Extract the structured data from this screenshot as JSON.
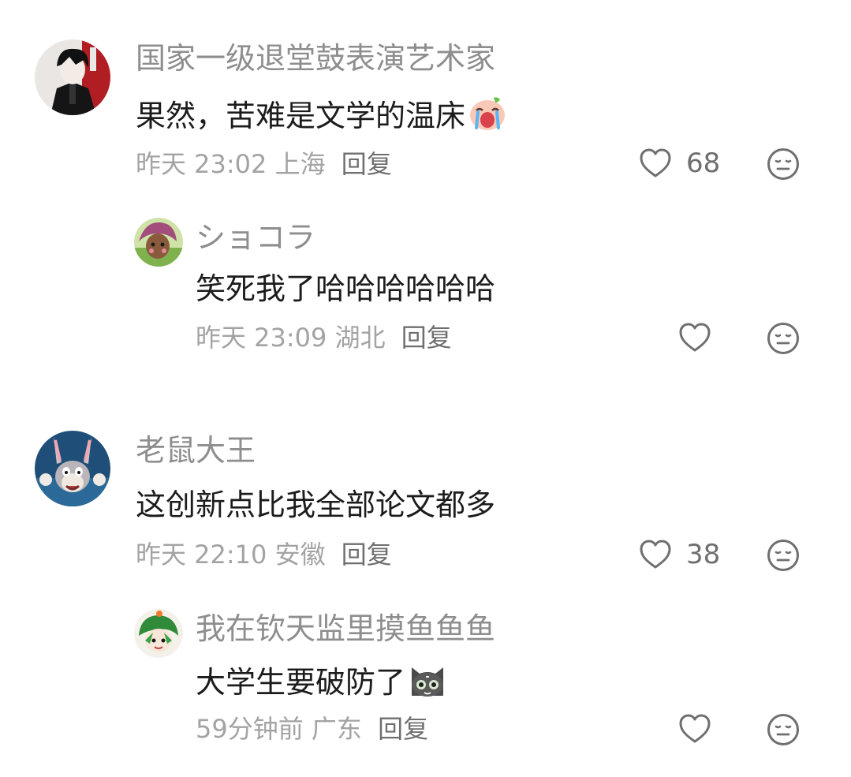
{
  "comments": [
    {
      "username": "国家一级退堂鼓表演艺术家",
      "content": "果然，苦难是文学的温床",
      "emoji": "crying-face-emoji",
      "time": "昨天 23:02",
      "location": "上海",
      "reply_label": "回复",
      "likes": "68"
    },
    {
      "username": "ショコラ",
      "content": "笑死我了哈哈哈哈哈哈",
      "time": "昨天 23:09",
      "location": "湖北",
      "reply_label": "回复",
      "likes": ""
    },
    {
      "username": "老鼠大王",
      "content": "这创新点比我全部论文都多",
      "time": "昨天 22:10",
      "location": "安徽",
      "reply_label": "回复",
      "likes": "38"
    },
    {
      "username": "我在钦天监里摸鱼鱼鱼",
      "content": "大学生要破防了",
      "emoji": "cat-face-emoji",
      "time": "59分钟前",
      "location": "广东",
      "reply_label": "回复",
      "likes": ""
    }
  ],
  "colors": {
    "username": "#8e8e8e",
    "content": "#1c1c1c",
    "meta": "#a3a3a3",
    "icon": "#6f6f6f"
  }
}
